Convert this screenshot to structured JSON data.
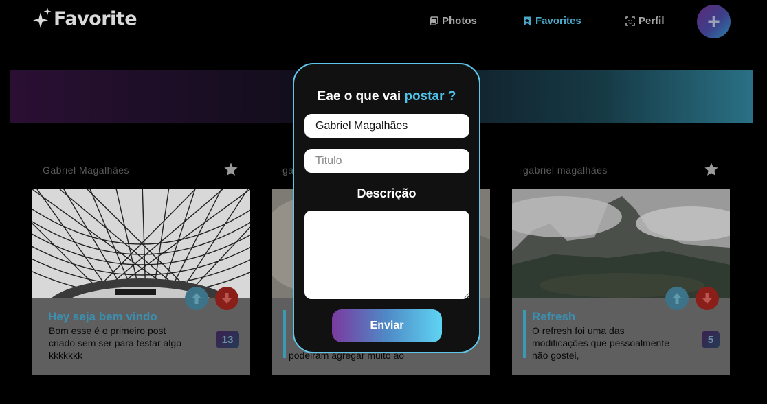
{
  "app": {
    "title": "Favorite"
  },
  "nav": {
    "photos": "Photos",
    "favorites": "Favorites",
    "profile": "Perfil",
    "add_label": "+"
  },
  "colors": {
    "accent": "#4fc3e9",
    "active_nav": "#4aa7c8",
    "downvote": "#8a1e18",
    "upvote": "#3c7388"
  },
  "cards": [
    {
      "author": "Gabriel Magalhães",
      "title": "Hey seja bem vindo",
      "text": "Bom esse é o primeiro post criado sem ser para testar algo kkkkkkk",
      "count": "13"
    },
    {
      "author": "ga",
      "title": "",
      "text": "podeiram agregar muito ao",
      "count": ""
    },
    {
      "author": "gabriel magalhães",
      "title": "Refresh",
      "text": "O refresh foi uma das modificações que pessoalmente não gostei,",
      "count": "5"
    }
  ],
  "modal": {
    "title_prefix": "Eae o que vai ",
    "title_highlight": "postar ?",
    "name_value": "Gabriel Magalhães",
    "title_placeholder": "Titulo",
    "desc_label": "Descrição",
    "submit_label": "Enviar"
  }
}
